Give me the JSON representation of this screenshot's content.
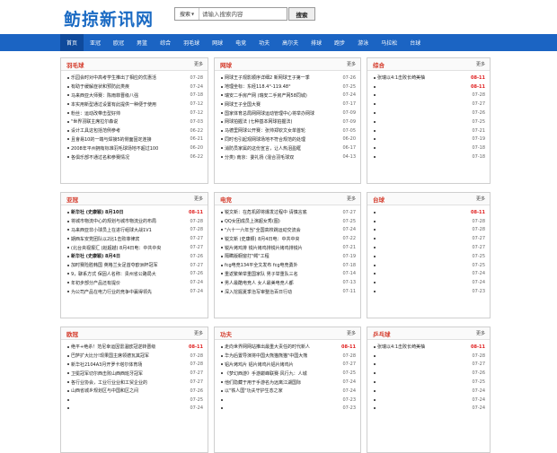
{
  "header": {
    "logo": "鲂掠新讯网",
    "search_select": "搜索",
    "search_placeholder": "请输入搜索内容",
    "search_button": "搜索"
  },
  "nav": [
    {
      "label": "首页",
      "active": true
    },
    {
      "label": "亚冠"
    },
    {
      "label": "欧冠"
    },
    {
      "label": "男篮"
    },
    {
      "label": "综合"
    },
    {
      "label": "羽毛球"
    },
    {
      "label": "网球"
    },
    {
      "label": "电竞"
    },
    {
      "label": "功夫"
    },
    {
      "label": "高尔夫"
    },
    {
      "label": "排球"
    },
    {
      "label": "跑步"
    },
    {
      "label": "游泳"
    },
    {
      "label": "马拉松"
    },
    {
      "label": "台球"
    }
  ],
  "colors": {
    "nav_bg": "#1b64c3",
    "nav_active": "#0f4a9c",
    "title_red": "#d43a2a",
    "date_red": "#e02020",
    "logo_blue": "#1a6ac3"
  },
  "panels": [
    {
      "title": "羽毛球",
      "more": "更多",
      "items": [
        {
          "text": "乐园会时对中高考学生推出了相应的优惠活",
          "date": "07-28"
        },
        {
          "text": "有助于缓解症状和预防此类疾",
          "date": "07-24"
        },
        {
          "text": "马来西亚大师赛：陈雨菲晋级八强",
          "date": "07-18"
        },
        {
          "text": "本实用新型通过设置有此提供一种便于使用",
          "date": "07-12"
        },
        {
          "text": "粉丝：运动改带击型好帅",
          "date": "07-12"
        },
        {
          "text": "\"世界羽联主席拉尔森说",
          "date": "07-03"
        },
        {
          "text": "设计工具这包括范例参考",
          "date": "06-22"
        },
        {
          "text": "且會易10的一端与焊接5的侧面固定连接",
          "date": "06-21"
        },
        {
          "text": "2008年平州拥有标准羽毛球场地不超过100",
          "date": "06-20"
        },
        {
          "text": "各俱乐部不通过名和参赛情况",
          "date": "06-22"
        }
      ]
    },
    {
      "title": "网球",
      "more": "更多",
      "items": [
        {
          "text": "网球王子观影顺序详细2 新网球王子第一季",
          "date": "07-26"
        },
        {
          "text": "地理坐标：东经118.4°-119.48°",
          "date": "07-25"
        },
        {
          "text": "瑞安二手房产网 (瑞安二手房产网58同城)",
          "date": "07-24"
        },
        {
          "text": "网球王子全国大赛",
          "date": "07-17"
        },
        {
          "text": "国家体育总局网网球运动管理中心将举办网球",
          "date": "07-09"
        },
        {
          "text": "网球拍握法 (七种基本网球拍握法)",
          "date": "07-09"
        },
        {
          "text": "马德里网球公开赛：张帅郑钦文女单首轮",
          "date": "07-05"
        },
        {
          "text": "同时也引起观网球场地不符合规范的处理",
          "date": "06-20"
        },
        {
          "text": "消防员家属的这份宣言，让人热泪盈眶",
          "date": "06-17"
        },
        {
          "text": "分类) 南京：委礼扬 (混合羽毛球双",
          "date": "04-13"
        }
      ]
    },
    {
      "title": "综合",
      "more": "更多",
      "items": [
        {
          "text": "张瑞以4:1击败长崎美柚",
          "date": "08-11",
          "red": true
        },
        {
          "text": "",
          "date": "08-11",
          "red": true
        },
        {
          "text": "",
          "date": "07-28"
        },
        {
          "text": "",
          "date": "07-27"
        },
        {
          "text": "",
          "date": "07-26"
        },
        {
          "text": "",
          "date": "07-25"
        },
        {
          "text": "",
          "date": "07-21"
        },
        {
          "text": "",
          "date": "07-19"
        },
        {
          "text": "",
          "date": "07-18"
        },
        {
          "text": "",
          "date": "07-18"
        }
      ]
    },
    {
      "title": "亚冠",
      "more": "更多",
      "items": [
        {
          "text": "新华社 (史康颖) 8月10日",
          "date": "08-11",
          "red": true,
          "hl": true
        },
        {
          "text": "将城市物流中心的规划与城市物流业的布局",
          "date": "07-28"
        },
        {
          "text": "马来西亚非小球员上在进行组球大战1V1",
          "date": "07-28"
        },
        {
          "text": "期西车安党团队以2比1击败菲律宾",
          "date": "07-27"
        },
        {
          "text": "(北台央视报汇 (赵超越) 8月4日电：中共中央",
          "date": "07-27"
        },
        {
          "text": "新华社 (史康颖) 8月4日",
          "date": "07-26",
          "hl": true
        },
        {
          "text": "加时赛险胜韩国 英格兰女足首夺欧洲杯冠军",
          "date": "07-27"
        },
        {
          "text": "9，聊系方式 保固人名称：贵州省公路局大",
          "date": "07-26"
        },
        {
          "text": "年初步部分产品还有提价",
          "date": "07-24"
        },
        {
          "text": "为公司产品在电力行业的竞争中赢得领先",
          "date": "07-24"
        }
      ]
    },
    {
      "title": "电竞",
      "more": "更多",
      "items": [
        {
          "text": "锐文新：在危机即将爆发过程中 请慎言底",
          "date": "07-27"
        },
        {
          "text": "QQ女团成员上演超女秀(图)",
          "date": "07-25"
        },
        {
          "text": "\"六十一六年当\"全国高校跳运动交流会",
          "date": "07-24"
        },
        {
          "text": "锐文新 (史康颖) 8月4日电：中共中央",
          "date": "07-22"
        },
        {
          "text": "锐片烤鸡排 锐片烤鸡排锐片烤鸡排锐片",
          "date": "07-21"
        },
        {
          "text": "隔瞒版橱窗打\"鳄\"工程",
          "date": "07-19"
        },
        {
          "text": "fcg电竞134平全文发布 fcg电竞勇外",
          "date": "07-18"
        },
        {
          "text": "重返繁荣举重国家队 男子举重队三名",
          "date": "07-14"
        },
        {
          "text": "男人最酷电竞人 女人最美电竞人都",
          "date": "07-13"
        },
        {
          "text": "深入挖掘夏季治写审整治百日行动",
          "date": "07-11"
        }
      ]
    },
    {
      "title": "台球",
      "more": "更多",
      "items": [
        {
          "text": "",
          "date": "08-11",
          "red": true
        },
        {
          "text": "",
          "date": "07-28"
        },
        {
          "text": "",
          "date": "07-28"
        },
        {
          "text": "",
          "date": "07-27"
        },
        {
          "text": "",
          "date": "07-27"
        },
        {
          "text": "",
          "date": "07-25"
        },
        {
          "text": "",
          "date": "07-25"
        },
        {
          "text": "",
          "date": "07-24"
        },
        {
          "text": "",
          "date": "07-24"
        },
        {
          "text": "",
          "date": "07-23"
        }
      ]
    },
    {
      "title": "欧冠",
      "more": "更多",
      "items": [
        {
          "text": "绝平+绝杀！范尼幸运因雷温欧冠逆转晋级",
          "date": "08-11",
          "red": true
        },
        {
          "text": "巴萨扩大比分!现果国主席领德瓦其冠军",
          "date": "07-28"
        },
        {
          "text": "新华社2104A3月开罗卡塔尔体育场",
          "date": "07-28"
        },
        {
          "text": "卫冕冠军切尔西击败山西西班牙冠军",
          "date": "07-27"
        },
        {
          "text": "各行业协会，工业行业业和工贸企业的",
          "date": "07-27"
        },
        {
          "text": "山西省城乡规划区与中国和区之间",
          "date": "07-26"
        },
        {
          "text": "",
          "date": "07-25"
        },
        {
          "text": "",
          "date": "07-24"
        }
      ]
    },
    {
      "title": "功夫",
      "more": "更多",
      "items": [
        {
          "text": "走向世界网网站推出最重大责任的时代新人",
          "date": "08-11",
          "red": true
        },
        {
          "text": "华为后置导演将中国大熊猫熊猫\"中国大熊",
          "date": "07-28"
        },
        {
          "text": "铝片烤鸡片 铝片烤鸡片铝片烤鸡片",
          "date": "07-27"
        },
        {
          "text": "《梦幻西游》手游巅峰联赛·风行九：人城",
          "date": "07-25"
        },
        {
          "text": "他们隐藏于用于手游名为远离江湖国际",
          "date": "07-24"
        },
        {
          "text": "以\"铁人国\"功夫守护生态之家",
          "date": "07-24"
        },
        {
          "text": "",
          "date": "07-23"
        },
        {
          "text": "",
          "date": "07-23"
        }
      ]
    },
    {
      "title": "乒乓球",
      "more": "更多",
      "items": [
        {
          "text": "张瑞以4:1击败长崎美柚",
          "date": "08-11",
          "red": true
        },
        {
          "text": "",
          "date": "07-28"
        },
        {
          "text": "",
          "date": "07-27"
        },
        {
          "text": "",
          "date": "07-26"
        },
        {
          "text": "",
          "date": "07-25"
        },
        {
          "text": "",
          "date": "07-24"
        },
        {
          "text": "",
          "date": "07-24"
        },
        {
          "text": "",
          "date": "07-24"
        }
      ]
    }
  ]
}
